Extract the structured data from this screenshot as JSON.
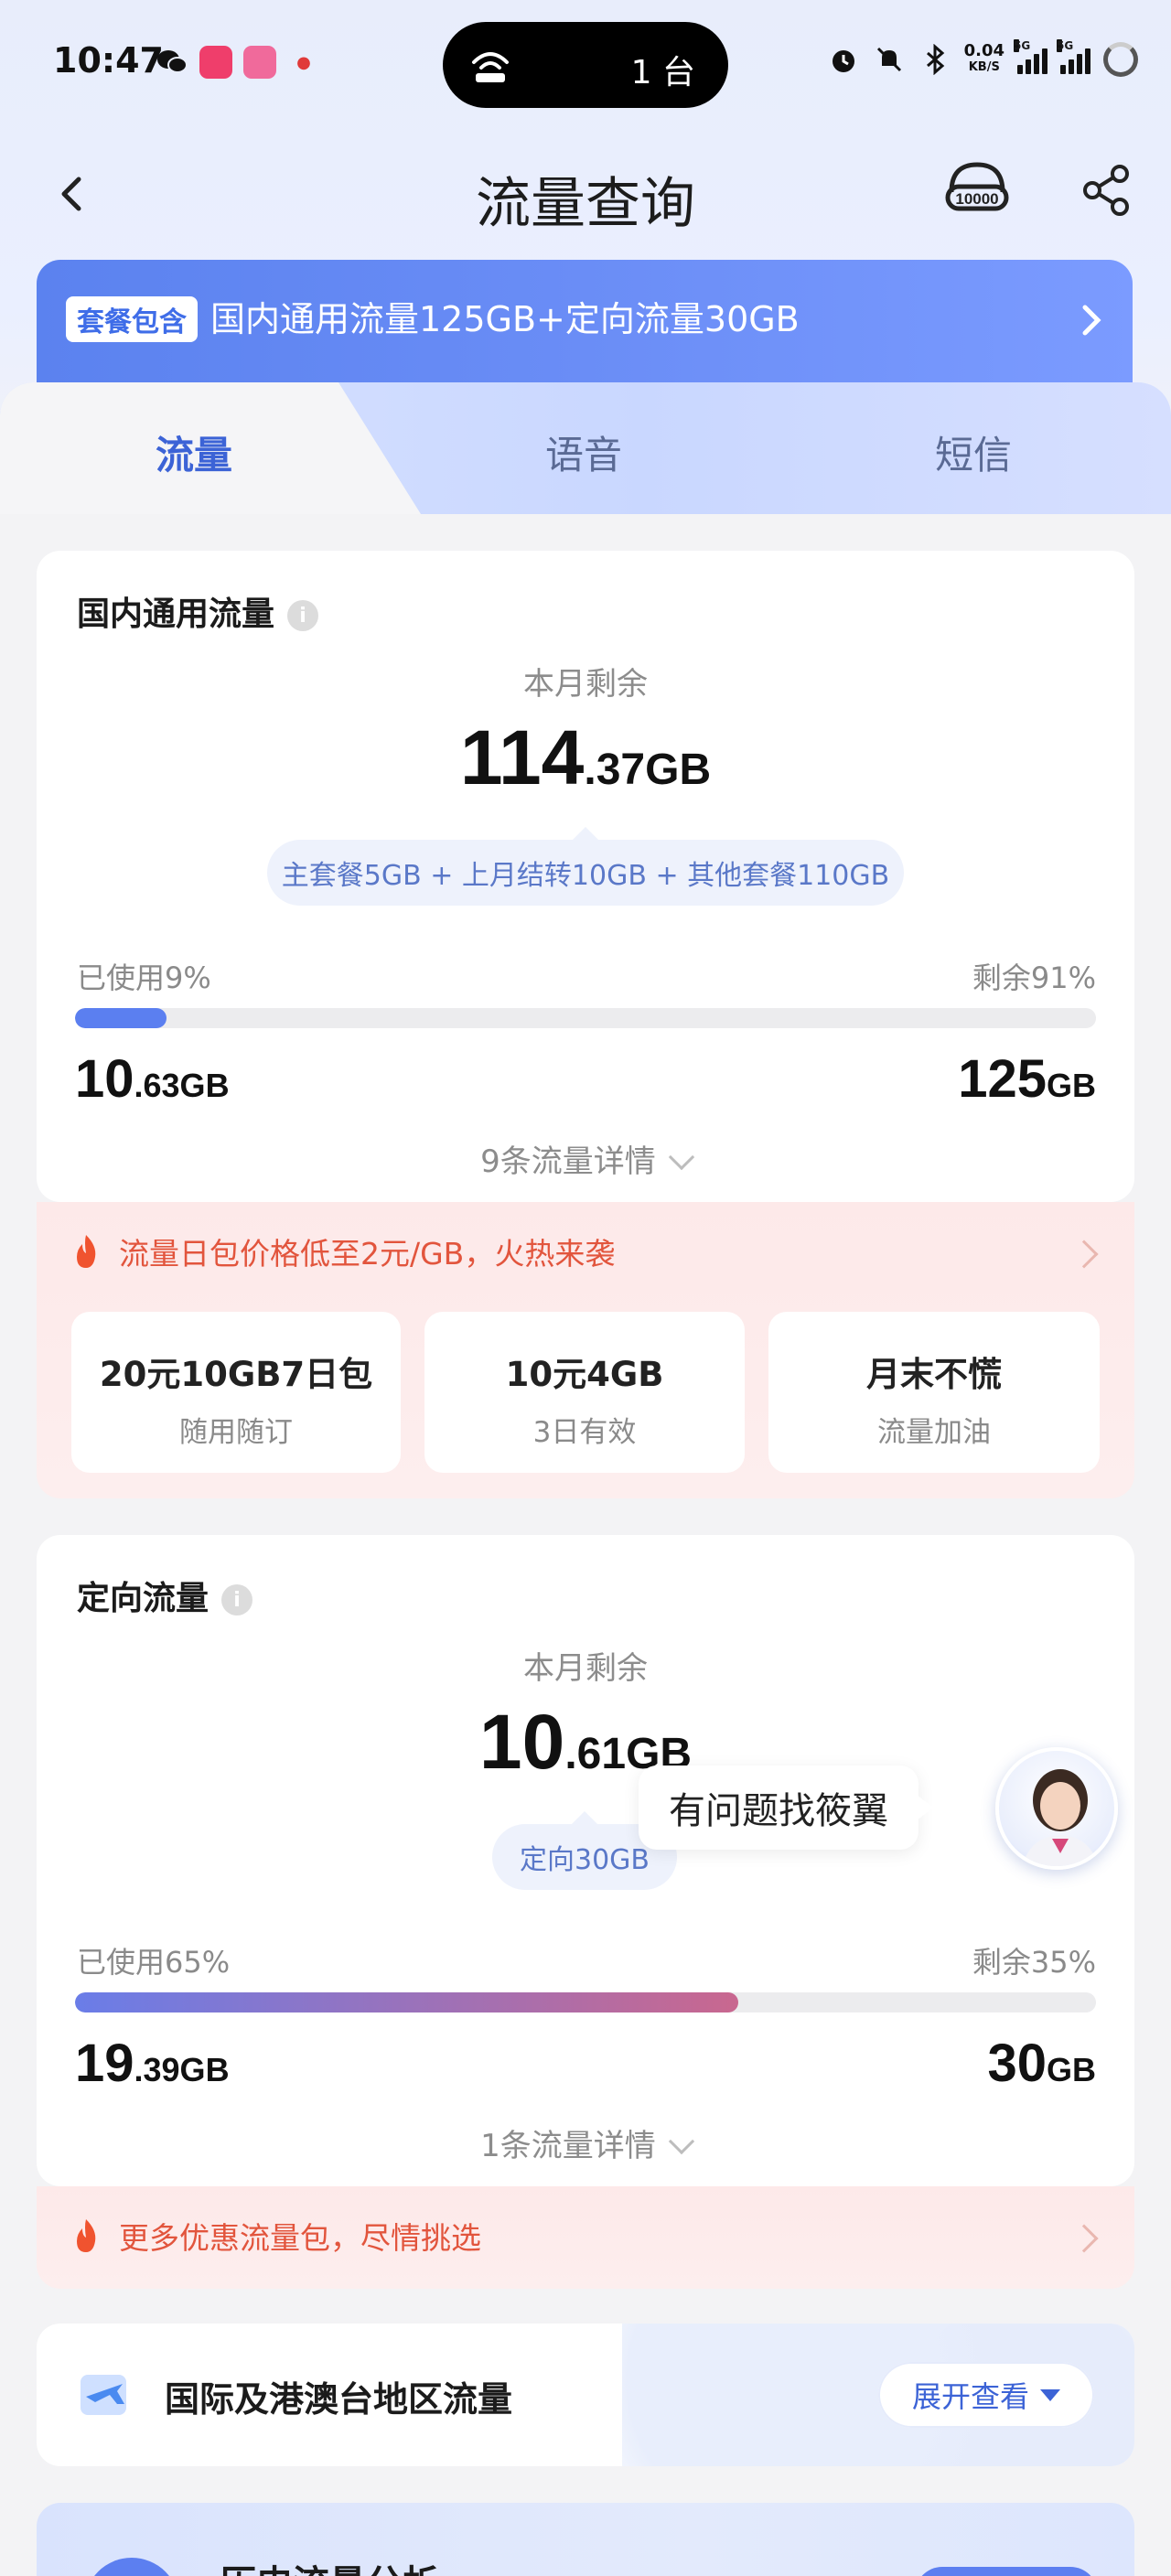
{
  "status_bar": {
    "time": "10:47",
    "island_text": "1 台",
    "net_speed": "0.04",
    "net_unit": "KB/S"
  },
  "header": {
    "title": "流量查询"
  },
  "package": {
    "badge": "套餐包含",
    "text": "国内通用流量125GB+定向流量30GB"
  },
  "tabs": [
    {
      "label": "流量",
      "active": true
    },
    {
      "label": "语音",
      "active": false
    },
    {
      "label": "短信",
      "active": false
    }
  ],
  "general": {
    "title": "国内通用流量",
    "remain_label": "本月剩余",
    "remain_int": "114",
    "remain_dec": ".37GB",
    "breakdown": "主套餐5GB + 上月结转10GB + 其他套餐110GB",
    "used_label": "已使用9%",
    "left_label": "剩余91%",
    "used_fraction": 0.09,
    "used_int": "10",
    "used_dec": ".63GB",
    "total_int": "125",
    "total_dec": "GB",
    "detail": "9条流量详情"
  },
  "general_promo": {
    "text": "流量日包价格低至2元/GB，火热来袭",
    "offers": [
      {
        "title": "20元10GB7日包",
        "sub": "随用随订"
      },
      {
        "title": "10元4GB",
        "sub": "3日有效"
      },
      {
        "title": "月末不慌",
        "sub": "流量加油"
      }
    ]
  },
  "directed": {
    "title": "定向流量",
    "remain_label": "本月剩余",
    "remain_int": "10",
    "remain_dec": ".61GB",
    "breakdown": "定向30GB",
    "used_label": "已使用65%",
    "left_label": "剩余35%",
    "used_fraction": 0.65,
    "used_int": "19",
    "used_dec": ".39GB",
    "total_int": "30",
    "total_dec": "GB",
    "detail": "1条流量详情"
  },
  "directed_promo": {
    "text": "更多优惠流量包，尽情挑选"
  },
  "assistant": {
    "bubble": "有问题找筱翼"
  },
  "international": {
    "title": "国际及港澳台地区流量",
    "button": "展开查看"
  },
  "history": {
    "title": "历史流量分析"
  },
  "colors": {
    "accent": "#3c63d6",
    "general_bar": "#5b7ff0",
    "directed_bar_start": "#6a7de8",
    "directed_bar_end": "#c9678f",
    "promo_text": "#e2553d"
  }
}
